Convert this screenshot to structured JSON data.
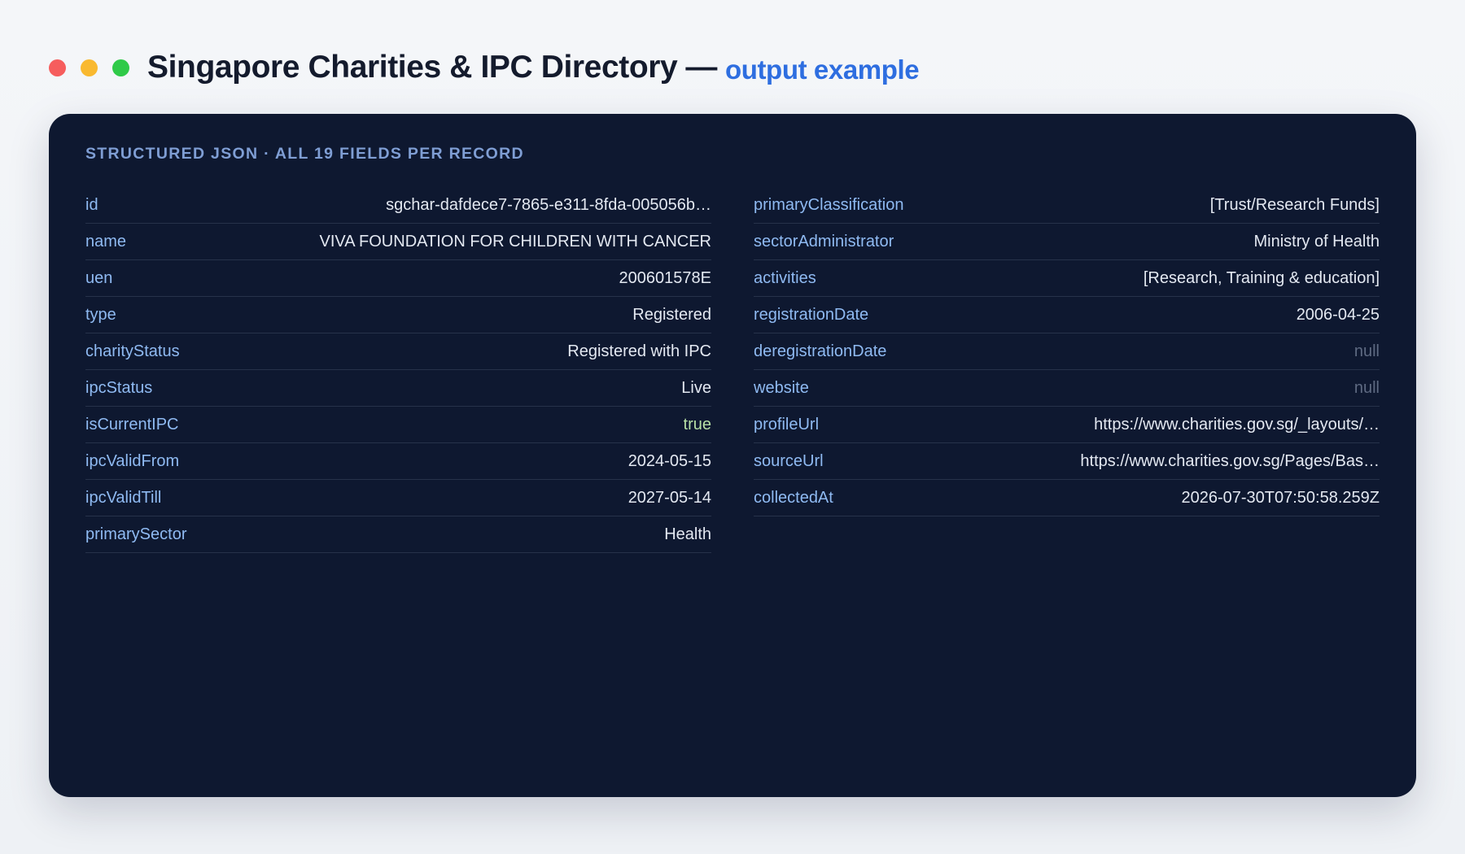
{
  "header": {
    "title": "Singapore Charities & IPC Directory",
    "separator": "—",
    "subtitle": "output example"
  },
  "panel": {
    "heading": "STRUCTURED JSON · ALL 19 FIELDS PER RECORD",
    "left_fields": [
      {
        "key": "id",
        "value": "sgchar-dafdece7-7865-e311-8fda-005056b…"
      },
      {
        "key": "name",
        "value": "VIVA FOUNDATION FOR CHILDREN WITH CANCER"
      },
      {
        "key": "uen",
        "value": "200601578E"
      },
      {
        "key": "type",
        "value": "Registered"
      },
      {
        "key": "charityStatus",
        "value": "Registered with IPC"
      },
      {
        "key": "ipcStatus",
        "value": "Live"
      },
      {
        "key": "isCurrentIPC",
        "value": "true"
      },
      {
        "key": "ipcValidFrom",
        "value": "2024-05-15"
      },
      {
        "key": "ipcValidTill",
        "value": "2027-05-14"
      },
      {
        "key": "primarySector",
        "value": "Health"
      }
    ],
    "right_fields": [
      {
        "key": "primaryClassification",
        "value": "[Trust/Research Funds]"
      },
      {
        "key": "sectorAdministrator",
        "value": "Ministry of Health"
      },
      {
        "key": "activities",
        "value": "[Research, Training & education]"
      },
      {
        "key": "registrationDate",
        "value": "2006-04-25"
      },
      {
        "key": "deregistrationDate",
        "value": "null"
      },
      {
        "key": "website",
        "value": "null"
      },
      {
        "key": "profileUrl",
        "value": "https://www.charities.gov.sg/_layouts/…"
      },
      {
        "key": "sourceUrl",
        "value": "https://www.charities.gov.sg/Pages/Bas…"
      },
      {
        "key": "collectedAt",
        "value": "2026-07-30T07:50:58.259Z"
      }
    ]
  },
  "colors": {
    "window_close": "#f65d5d",
    "window_minimize": "#f9b92f",
    "window_maximize": "#2fca48",
    "panel_background": "#0e1830",
    "key_text": "#8fbaf2",
    "value_text": "#e3e8f1",
    "null_text": "#5e6a82",
    "boolean_text": "#b7e0a6",
    "subtitle_accent": "#2e6ee0"
  }
}
